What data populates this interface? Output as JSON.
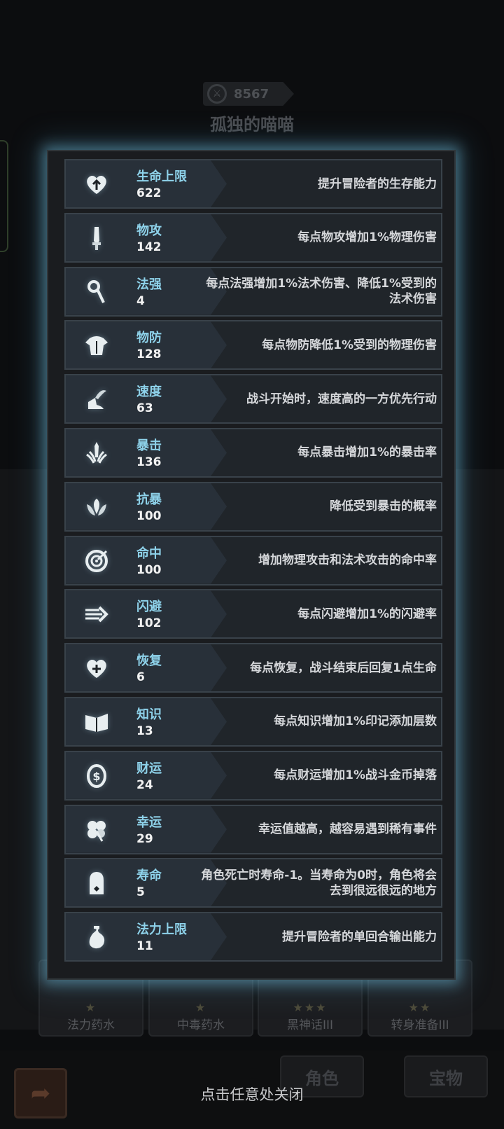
{
  "header": {
    "power_value": "8567",
    "player_name": "孤独的喵喵"
  },
  "background_cards": [
    {
      "name": "法力药水",
      "stars": "★"
    },
    {
      "name": "中毒药水",
      "stars": "★"
    },
    {
      "name": "黑神话III",
      "stars": "★★★"
    },
    {
      "name": "转身准备III",
      "stars": "★★"
    }
  ],
  "bottom_tabs": {
    "role": "角色",
    "treasure": "宝物"
  },
  "close_hint": "点击任意处关闭",
  "stats": [
    {
      "icon": "heart-up-icon",
      "name": "生命上限",
      "value": "622",
      "desc": "提升冒险者的生存能力"
    },
    {
      "icon": "sword-icon",
      "name": "物攻",
      "value": "142",
      "desc": "每点物攻增加1%物理伤害"
    },
    {
      "icon": "staff-icon",
      "name": "法强",
      "value": "4",
      "desc": "每点法强增加1%法术伤害、降低1%受到的法术伤害"
    },
    {
      "icon": "armor-icon",
      "name": "物防",
      "value": "128",
      "desc": "每点物防降低1%受到的物理伤害"
    },
    {
      "icon": "winged-boot-icon",
      "name": "速度",
      "value": "63",
      "desc": "战斗开始时，速度高的一方优先行动"
    },
    {
      "icon": "crit-icon",
      "name": "暴击",
      "value": "136",
      "desc": "每点暴击增加1%的暴击率"
    },
    {
      "icon": "crit-resist-icon",
      "name": "抗暴",
      "value": "100",
      "desc": "降低受到暴击的概率"
    },
    {
      "icon": "target-icon",
      "name": "命中",
      "value": "100",
      "desc": "增加物理攻击和法术攻击的命中率"
    },
    {
      "icon": "dodge-icon",
      "name": "闪避",
      "value": "102",
      "desc": "每点闪避增加1%的闪避率"
    },
    {
      "icon": "heart-plus-icon",
      "name": "恢复",
      "value": "6",
      "desc": "每点恢复，战斗结束后回复1点生命"
    },
    {
      "icon": "book-icon",
      "name": "知识",
      "value": "13",
      "desc": "每点知识增加1%印记添加层数"
    },
    {
      "icon": "coin-icon",
      "name": "财运",
      "value": "24",
      "desc": "每点财运增加1%战斗金币掉落"
    },
    {
      "icon": "clover-icon",
      "name": "幸运",
      "value": "29",
      "desc": "幸运值越高，越容易遇到稀有事件"
    },
    {
      "icon": "tombstone-icon",
      "name": "寿命",
      "value": "5",
      "desc": "角色死亡时寿命-1。当寿命为0时，角色将会去到很远很远的地方"
    },
    {
      "icon": "mana-flask-icon",
      "name": "法力上限",
      "value": "11",
      "desc": "提升冒险者的单回合输出能力"
    }
  ]
}
